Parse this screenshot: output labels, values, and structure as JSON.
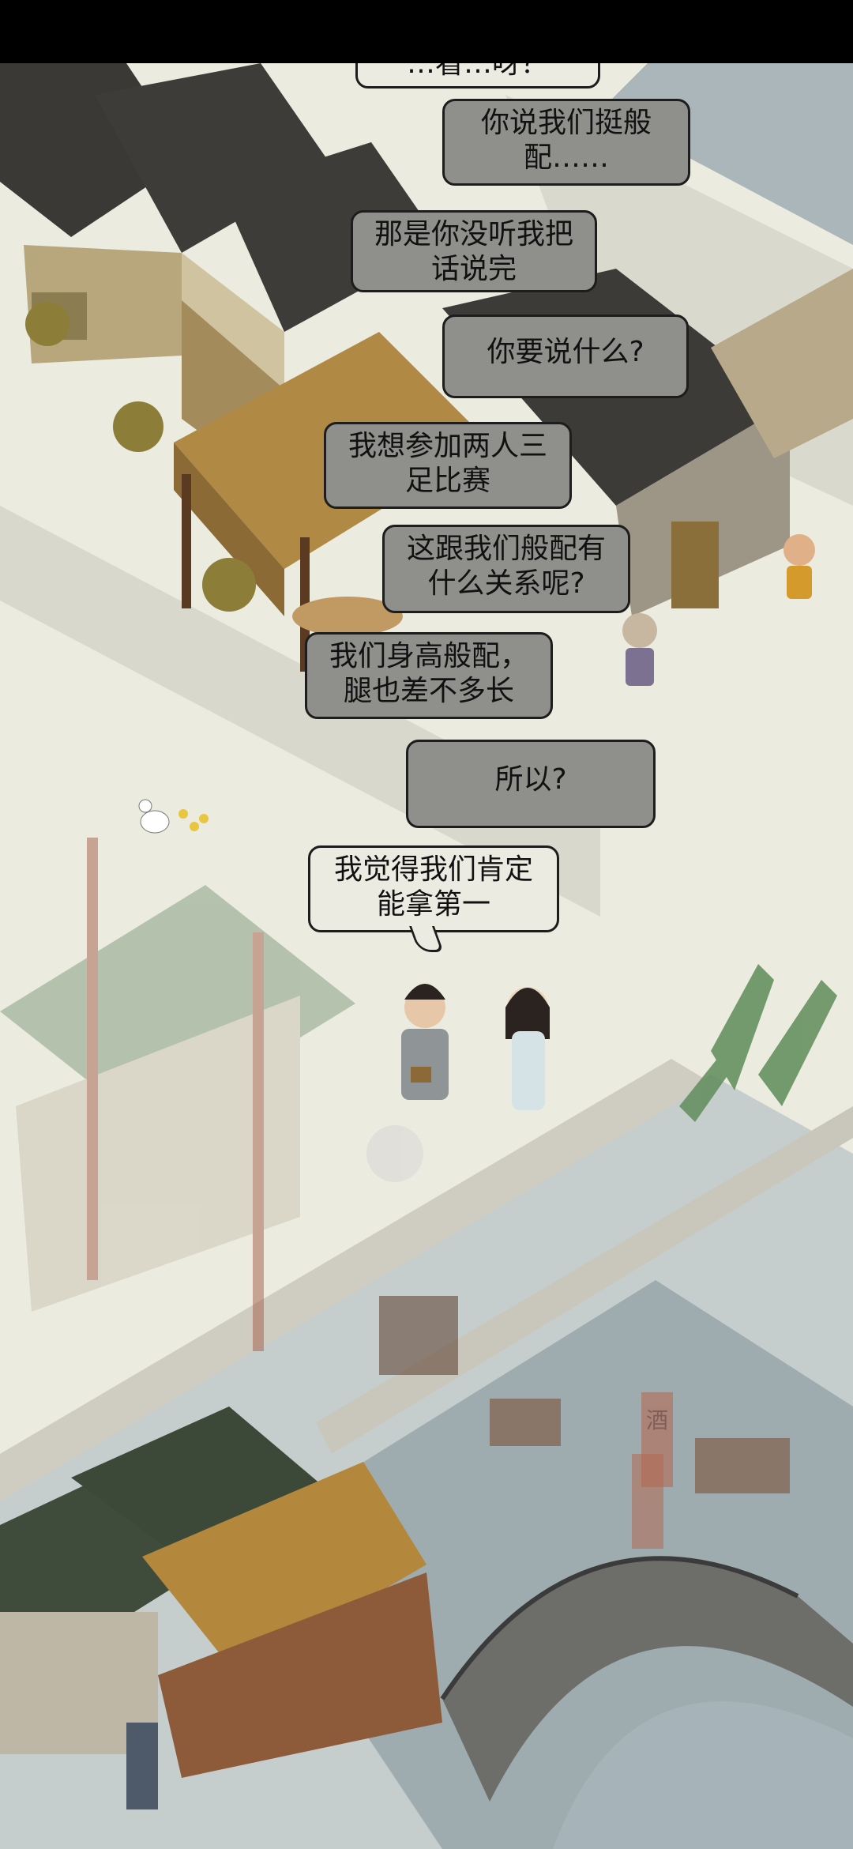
{
  "dialogue": {
    "partial_top": "…看…呀？",
    "lines": [
      "你说我们挺般配……",
      "那是你没听我把话说完",
      "你要说什么?",
      "我想参加两人三足比赛",
      "这跟我们般配有什么关系呢?",
      "我们身高般配，腿也差不多长",
      "所以?",
      "我觉得我们肯定能拿第一"
    ]
  },
  "shop_sign": "酒"
}
